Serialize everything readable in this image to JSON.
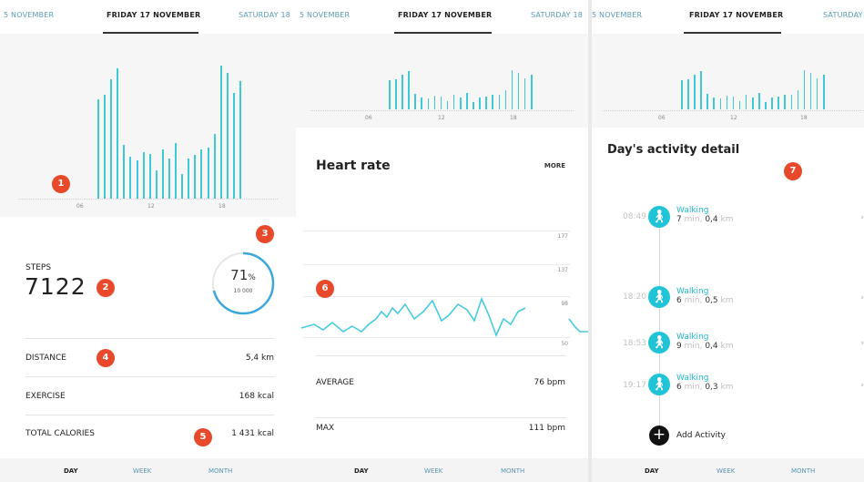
{
  "panel1": {
    "dates": {
      "prev": "5 NOVEMBER",
      "current": "FRIDAY 17 NOVEMBER",
      "next": "SATURDAY 18"
    },
    "axis_ticks": [
      "06",
      "12",
      "18"
    ],
    "steps_label": "STEPS",
    "steps_value": "7122",
    "goal_percent": "71",
    "goal_percent_sign": "%",
    "goal_value": "10 000",
    "goal_progress": 0.71,
    "rows": [
      {
        "label": "DISTANCE",
        "value": "5,4 km"
      },
      {
        "label": "EXERCISE",
        "value": "168 kcal"
      },
      {
        "label": "TOTAL CALORIES",
        "value": "1 431 kcal"
      }
    ],
    "badges": [
      "1",
      "2",
      "3",
      "4",
      "5"
    ],
    "tabs": [
      "DAY",
      "WEEK",
      "MONTH"
    ]
  },
  "panel2": {
    "dates": {
      "prev": "5 NOVEMBER",
      "current": "FRIDAY 17 NOVEMBER",
      "next": "SATURDAY 18"
    },
    "axis_ticks": [
      "06",
      "12",
      "18"
    ],
    "title": "Heart rate",
    "more": "MORE",
    "y_ticks": [
      "177",
      "137",
      "98",
      "50"
    ],
    "average_label": "AVERAGE",
    "average_value": "76 bpm",
    "max_label": "MAX",
    "max_value": "111 bpm",
    "badge": "6",
    "tabs": [
      "DAY",
      "WEEK",
      "MONTH"
    ]
  },
  "panel3": {
    "dates": {
      "prev": "5 NOVEMBER",
      "current": "FRIDAY 17 NOVEMBER",
      "next": "SATURDAY"
    },
    "axis_ticks": [
      "06",
      "12",
      "18"
    ],
    "title": "Day's activity detail",
    "badge": "7",
    "activities": [
      {
        "time": "08:49",
        "type": "Walking",
        "duration": "7",
        "duration_unit": "min,",
        "distance": "0,4",
        "distance_unit": "km"
      },
      {
        "time": "18:20",
        "type": "Walking",
        "duration": "6",
        "duration_unit": "min,",
        "distance": "0,5",
        "distance_unit": "km"
      },
      {
        "time": "18:53",
        "type": "Walking",
        "duration": "9",
        "duration_unit": "min,",
        "distance": "0,4",
        "distance_unit": "km"
      },
      {
        "time": "19:17",
        "type": "Walking",
        "duration": "6",
        "duration_unit": "min,",
        "distance": "0,3",
        "distance_unit": "km"
      }
    ],
    "add_activity": "Add Activity",
    "tabs": [
      "DAY",
      "WEEK",
      "MONTH"
    ]
  },
  "colors": {
    "accent": "#3ec8d8",
    "badge": "#e8492b",
    "link": "#5b9ab6"
  },
  "chart_data": {
    "type": "bar",
    "title": "",
    "xlabel": "",
    "ylabel": "",
    "x_ticks": [
      "06",
      "12",
      "18"
    ],
    "relative_values": [
      0.64,
      0.67,
      0.77,
      0.84,
      0.35,
      0.27,
      0.25,
      0.3,
      0.29,
      0.18,
      0.32,
      0.26,
      0.36,
      0.16,
      0.26,
      0.28,
      0.32,
      0.33,
      0.42,
      0.86,
      0.81,
      0.68,
      0.76
    ],
    "grid": false,
    "legend": "none"
  }
}
